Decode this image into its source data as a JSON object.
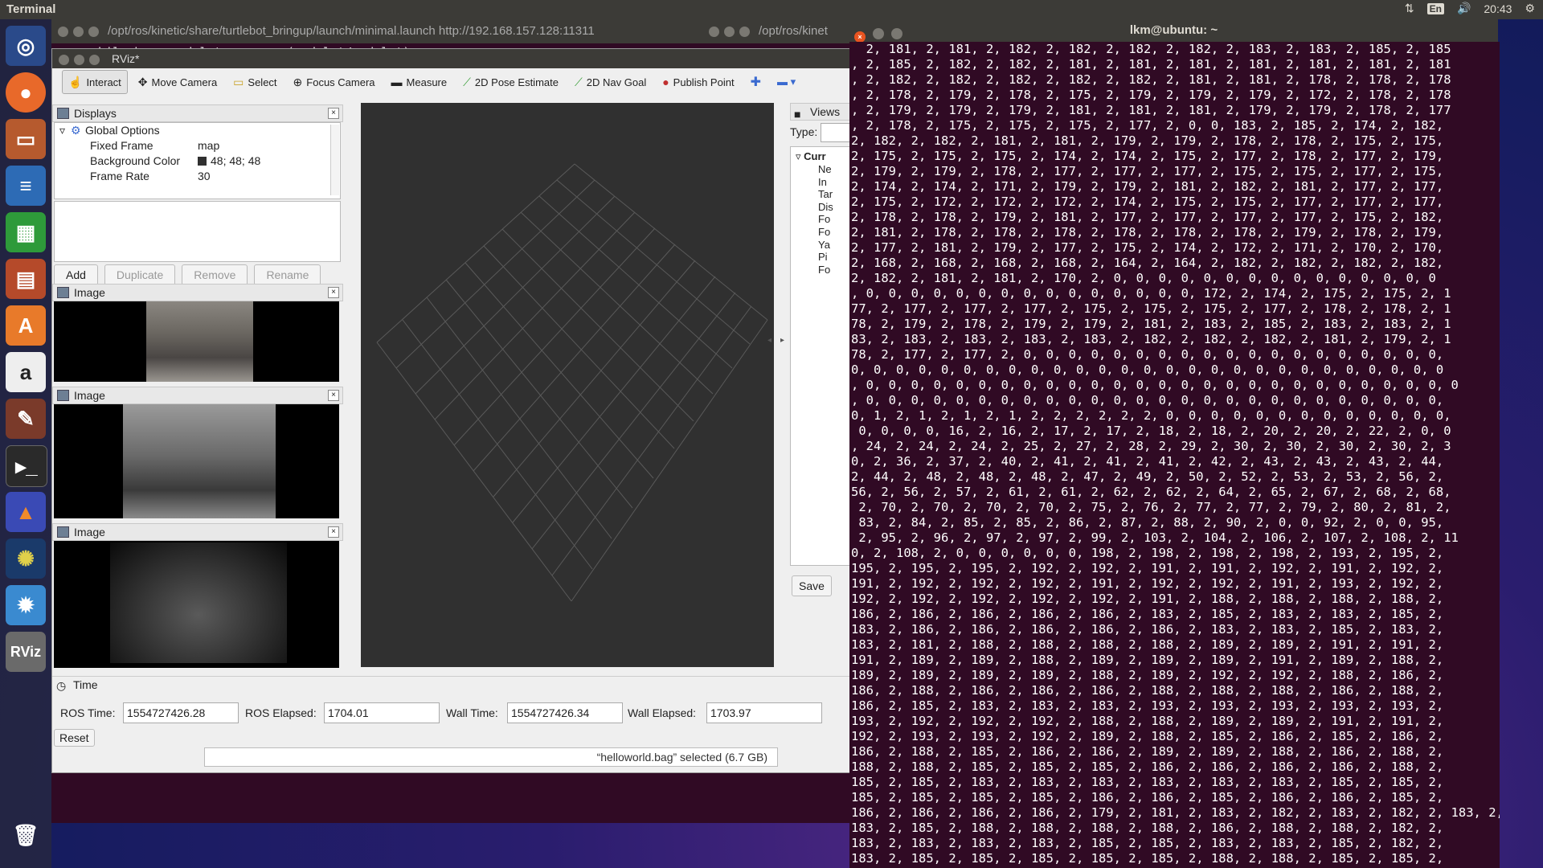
{
  "top_panel": {
    "app_title": "Terminal",
    "lang": "En",
    "clock": "20:43"
  },
  "launcher": {
    "items": [
      "ubuntu-dash",
      "firefox",
      "files",
      "writer",
      "calc",
      "impress",
      "software-center",
      "amazon",
      "settings",
      "terminal",
      "matlab",
      "app",
      "app",
      "rviz",
      "trash"
    ],
    "rviz_label": "RViz",
    "amazon_label": "a"
  },
  "bg_terminal": {
    "tab1": "/opt/ros/kinetic/share/turtlebot_bringup/launch/minimal.launch http://192.168.157.128:11311",
    "tab2": "/opt/ros/kinet",
    "line1": "mobile_base_nodelet_manager (nodelet/nodelet)"
  },
  "rviz": {
    "title": "RViz*",
    "toolbar": {
      "interact": "Interact",
      "move_camera": "Move Camera",
      "select": "Select",
      "focus_camera": "Focus Camera",
      "measure": "Measure",
      "pose_estimate": "2D Pose Estimate",
      "nav_goal": "2D Nav Goal",
      "publish_point": "Publish Point"
    },
    "displays": {
      "title": "Displays",
      "global_options": "Global Options",
      "rows": [
        {
          "key": "Fixed Frame",
          "value": "map"
        },
        {
          "key": "Background Color",
          "value": "48; 48; 48"
        },
        {
          "key": "Frame Rate",
          "value": "30"
        }
      ],
      "buttons": {
        "add": "Add",
        "duplicate": "Duplicate",
        "remove": "Remove",
        "rename": "Rename"
      }
    },
    "image_panels": [
      {
        "title": "Image"
      },
      {
        "title": "Image"
      },
      {
        "title": "Image"
      }
    ],
    "views": {
      "title": "Views",
      "type_label": "Type:",
      "current": "Curr",
      "props": [
        "Ne",
        "In",
        "Tar",
        "Dis",
        "Fo",
        "Fo",
        "Ya",
        "Pi",
        "Fo"
      ],
      "save": "Save"
    },
    "time": {
      "title": "Time",
      "ros_time_label": "ROS Time:",
      "ros_time": "1554727426.28",
      "ros_elapsed_label": "ROS Elapsed:",
      "ros_elapsed": "1704.01",
      "wall_time_label": "Wall Time:",
      "wall_time": "1554727426.34",
      "wall_elapsed_label": "Wall Elapsed:",
      "wall_elapsed": "1703.97",
      "reset": "Reset"
    }
  },
  "status_note": "“helloworld.bag” selected (6.7 GB)",
  "terminal": {
    "title": "lkm@ubuntu: ~",
    "lines": [
      "  2, 181, 2, 181, 2, 182, 2, 182, 2, 182, 2, 182, 2, 183, 2, 183, 2, 185, 2, 185",
      ", 2, 185, 2, 182, 2, 182, 2, 181, 2, 181, 2, 181, 2, 181, 2, 181, 2, 181, 2, 181",
      ", 2, 182, 2, 182, 2, 182, 2, 182, 2, 182, 2, 181, 2, 181, 2, 178, 2, 178, 2, 178",
      ", 2, 178, 2, 179, 2, 178, 2, 175, 2, 179, 2, 179, 2, 179, 2, 172, 2, 178, 2, 178",
      ", 2, 179, 2, 179, 2, 179, 2, 181, 2, 181, 2, 181, 2, 179, 2, 179, 2, 178, 2, 177",
      ", 2, 178, 2, 175, 2, 175, 2, 175, 2, 177, 2, 0, 0, 183, 2, 185, 2, 174, 2, 182,",
      "2, 182, 2, 182, 2, 181, 2, 181, 2, 179, 2, 179, 2, 178, 2, 178, 2, 175, 2, 175,",
      "2, 175, 2, 175, 2, 175, 2, 174, 2, 174, 2, 175, 2, 177, 2, 178, 2, 177, 2, 179,",
      "2, 179, 2, 179, 2, 178, 2, 177, 2, 177, 2, 177, 2, 175, 2, 175, 2, 177, 2, 175,",
      "2, 174, 2, 174, 2, 171, 2, 179, 2, 179, 2, 181, 2, 182, 2, 181, 2, 177, 2, 177,",
      "2, 175, 2, 172, 2, 172, 2, 172, 2, 174, 2, 175, 2, 175, 2, 177, 2, 177, 2, 177,",
      "2, 178, 2, 178, 2, 179, 2, 181, 2, 177, 2, 177, 2, 177, 2, 177, 2, 175, 2, 182,",
      "2, 181, 2, 178, 2, 178, 2, 178, 2, 178, 2, 178, 2, 178, 2, 179, 2, 178, 2, 179,",
      "2, 177, 2, 181, 2, 179, 2, 177, 2, 175, 2, 174, 2, 172, 2, 171, 2, 170, 2, 170,",
      "2, 168, 2, 168, 2, 168, 2, 168, 2, 164, 2, 164, 2, 182, 2, 182, 2, 182, 2, 182,",
      "2, 182, 2, 181, 2, 181, 2, 170, 2, 0, 0, 0, 0, 0, 0, 0, 0, 0, 0, 0, 0, 0, 0, 0",
      ", 0, 0, 0, 0, 0, 0, 0, 0, 0, 0, 0, 0, 0, 0, 0, 172, 2, 174, 2, 175, 2, 175, 2, 1",
      "77, 2, 177, 2, 177, 2, 177, 2, 175, 2, 175, 2, 175, 2, 177, 2, 178, 2, 178, 2, 1",
      "78, 2, 179, 2, 178, 2, 179, 2, 179, 2, 181, 2, 183, 2, 185, 2, 183, 2, 183, 2, 1",
      "83, 2, 183, 2, 183, 2, 183, 2, 183, 2, 182, 2, 182, 2, 182, 2, 181, 2, 179, 2, 1",
      "78, 2, 177, 2, 177, 2, 0, 0, 0, 0, 0, 0, 0, 0, 0, 0, 0, 0, 0, 0, 0, 0, 0, 0, 0,",
      "0, 0, 0, 0, 0, 0, 0, 0, 0, 0, 0, 0, 0, 0, 0, 0, 0, 0, 0, 0, 0, 0, 0, 0, 0, 0, 0",
      ", 0, 0, 0, 0, 0, 0, 0, 0, 0, 0, 0, 0, 0, 0, 0, 0, 0, 0, 0, 0, 0, 0, 0, 0, 0, 0, 0",
      ", 0, 0, 0, 0, 0, 0, 0, 0, 0, 0, 0, 0, 0, 0, 0, 0, 0, 0, 0, 0, 0, 0, 0, 0, 0, 0,",
      "0, 1, 2, 1, 2, 1, 2, 1, 2, 2, 2, 2, 2, 2, 0, 0, 0, 0, 0, 0, 0, 0, 0, 0, 0, 0, 0,",
      " 0, 0, 0, 0, 16, 2, 16, 2, 17, 2, 17, 2, 18, 2, 18, 2, 20, 2, 20, 2, 22, 2, 0, 0",
      ", 24, 2, 24, 2, 24, 2, 25, 2, 27, 2, 28, 2, 29, 2, 30, 2, 30, 2, 30, 2, 30, 2, 3",
      "0, 2, 36, 2, 37, 2, 40, 2, 41, 2, 41, 2, 41, 2, 42, 2, 43, 2, 43, 2, 43, 2, 44,",
      "2, 44, 2, 48, 2, 48, 2, 48, 2, 47, 2, 49, 2, 50, 2, 52, 2, 53, 2, 53, 2, 56, 2,",
      "56, 2, 56, 2, 57, 2, 61, 2, 61, 2, 62, 2, 62, 2, 64, 2, 65, 2, 67, 2, 68, 2, 68,",
      " 2, 70, 2, 70, 2, 70, 2, 70, 2, 75, 2, 76, 2, 77, 2, 77, 2, 79, 2, 80, 2, 81, 2,",
      " 83, 2, 84, 2, 85, 2, 85, 2, 86, 2, 87, 2, 88, 2, 90, 2, 0, 0, 92, 2, 0, 0, 95,",
      " 2, 95, 2, 96, 2, 97, 2, 97, 2, 99, 2, 103, 2, 104, 2, 106, 2, 107, 2, 108, 2, 11",
      "0, 2, 108, 2, 0, 0, 0, 0, 0, 0, 198, 2, 198, 2, 198, 2, 198, 2, 193, 2, 195, 2,",
      "195, 2, 195, 2, 195, 2, 192, 2, 192, 2, 191, 2, 191, 2, 192, 2, 191, 2, 192, 2,",
      "191, 2, 192, 2, 192, 2, 192, 2, 191, 2, 192, 2, 192, 2, 191, 2, 193, 2, 192, 2,",
      "192, 2, 192, 2, 192, 2, 192, 2, 192, 2, 191, 2, 188, 2, 188, 2, 188, 2, 188, 2,",
      "186, 2, 186, 2, 186, 2, 186, 2, 186, 2, 183, 2, 185, 2, 183, 2, 183, 2, 185, 2,",
      "183, 2, 186, 2, 186, 2, 186, 2, 186, 2, 186, 2, 183, 2, 183, 2, 185, 2, 183, 2,",
      "183, 2, 181, 2, 188, 2, 188, 2, 188, 2, 188, 2, 189, 2, 189, 2, 191, 2, 191, 2,",
      "191, 2, 189, 2, 189, 2, 188, 2, 189, 2, 189, 2, 189, 2, 191, 2, 189, 2, 188, 2,",
      "189, 2, 189, 2, 189, 2, 189, 2, 188, 2, 189, 2, 192, 2, 192, 2, 188, 2, 186, 2,",
      "186, 2, 188, 2, 186, 2, 186, 2, 186, 2, 188, 2, 188, 2, 188, 2, 186, 2, 188, 2,",
      "186, 2, 185, 2, 183, 2, 183, 2, 183, 2, 193, 2, 193, 2, 193, 2, 193, 2, 193, 2,",
      "193, 2, 192, 2, 192, 2, 192, 2, 188, 2, 188, 2, 189, 2, 189, 2, 191, 2, 191, 2,",
      "192, 2, 193, 2, 193, 2, 192, 2, 189, 2, 188, 2, 185, 2, 186, 2, 185, 2, 186, 2,",
      "186, 2, 188, 2, 185, 2, 186, 2, 186, 2, 189, 2, 189, 2, 188, 2, 186, 2, 188, 2,",
      "188, 2, 188, 2, 185, 2, 185, 2, 185, 2, 186, 2, 186, 2, 186, 2, 186, 2, 188, 2,",
      "185, 2, 185, 2, 183, 2, 183, 2, 183, 2, 183, 2, 183, 2, 183, 2, 185, 2, 185, 2,",
      "185, 2, 185, 2, 185, 2, 185, 2, 186, 2, 186, 2, 185, 2, 186, 2, 186, 2, 185, 2,",
      "186, 2, 186, 2, 186, 2, 186, 2, 179, 2, 181, 2, 183, 2, 182, 2, 183, 2, 182, 2, 183, 2,",
      "183, 2, 185, 2, 188, 2, 188, 2, 188, 2, 188, 2, 186, 2, 188, 2, 188, 2, 182, 2,",
      "183, 2, 183, 2, 183, 2, 183, 2, 185, 2, 185, 2, 183, 2, 183, 2, 185, 2, 182, 2,",
      "183, 2, 185, 2, 185, 2, 185, 2, 185, 2, 185, 2, 188, 2, 188, 2, 185, 2, 185, 2,"
    ]
  },
  "colors": {
    "terminal_bg": "#300a24",
    "panel": "#3c3b37",
    "viewport_bg": "#303030"
  }
}
